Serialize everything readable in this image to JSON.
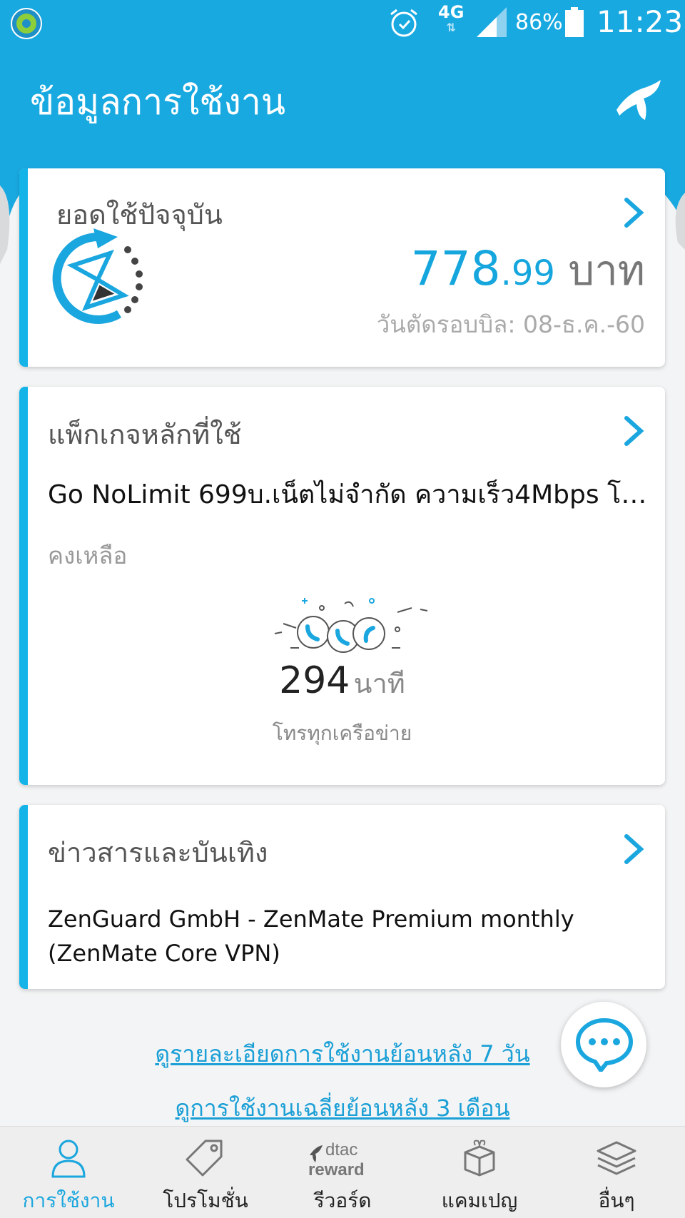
{
  "status_bar": {
    "network": "4G",
    "battery": "86%",
    "time": "11:23"
  },
  "header": {
    "title": "ข้อมูลการใช้งาน"
  },
  "bill_card": {
    "title": "ยอดใช้ปัจจุบัน",
    "amount_int": "778",
    "amount_dec": ".99",
    "currency": "บาท",
    "cycle": "วันตัดรอบบิล: 08-ธ.ค.-60"
  },
  "package_card": {
    "title": "แพ็กเกจหลักที่ใช้",
    "package_name": "Go NoLimit 699บ.เน็ตไม่จำกัด ความเร็ว4Mbps โทร...",
    "remaining_label": "คงเหลือ",
    "minutes": "294",
    "minutes_unit": "นาที",
    "network_label": "โทรทุกเครือข่าย"
  },
  "news_card": {
    "title": "ข่าวสารและบันเทิง",
    "text": "ZenGuard GmbH - ZenMate Premium monthly (ZenMate Core VPN)"
  },
  "links": {
    "seven_day": "ดูรายละเอียดการใช้งานย้อนหลัง 7 วัน",
    "three_month": "ดูการใช้งานเฉลี่ยย้อนหลัง 3 เดือน"
  },
  "bottom_nav": {
    "items": [
      {
        "label": "การใช้งาน",
        "icon": "person-icon",
        "active": true
      },
      {
        "label": "โปรโมชั่น",
        "icon": "tag-icon",
        "active": false
      },
      {
        "label": "รีวอร์ด",
        "icon": "dtac-reward-icon",
        "active": false
      },
      {
        "label": "แคมเปญ",
        "icon": "gift-box-icon",
        "active": false
      },
      {
        "label": "อื่นๆ",
        "icon": "stack-icon",
        "active": false
      }
    ],
    "reward_logo_text_top": "dtac",
    "reward_logo_text_bottom": "reward"
  },
  "colors": {
    "brand": "#19a9e1",
    "accent": "#14b3e8",
    "link": "#1a9fd6"
  }
}
